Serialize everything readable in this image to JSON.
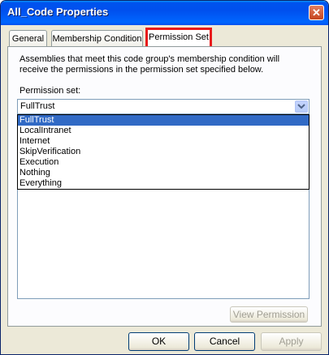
{
  "window": {
    "title": "All_Code Properties",
    "close_glyph": "✕"
  },
  "tabs": [
    {
      "label": "General"
    },
    {
      "label": "Membership Condition"
    },
    {
      "label": "Permission Set"
    }
  ],
  "panel": {
    "description": "Assemblies that meet this code group's membership condition will receive the permissions in the permission set specified below.",
    "permission_label": "Permission set:",
    "combo": {
      "value": "FullTrust",
      "icon": "chevron-down-icon"
    },
    "options": [
      "FullTrust",
      "LocalIntranet",
      "Internet",
      "SkipVerification",
      "Execution",
      "Nothing",
      "Everything"
    ],
    "selected_option": "FullTrust",
    "view_permission_label": "View Permission"
  },
  "buttons": {
    "ok": "OK",
    "cancel": "Cancel",
    "apply": "Apply"
  },
  "colors": {
    "highlight": "#316ac5",
    "tab_outline": "#e81b1b",
    "titlebar": "#0053ee"
  }
}
